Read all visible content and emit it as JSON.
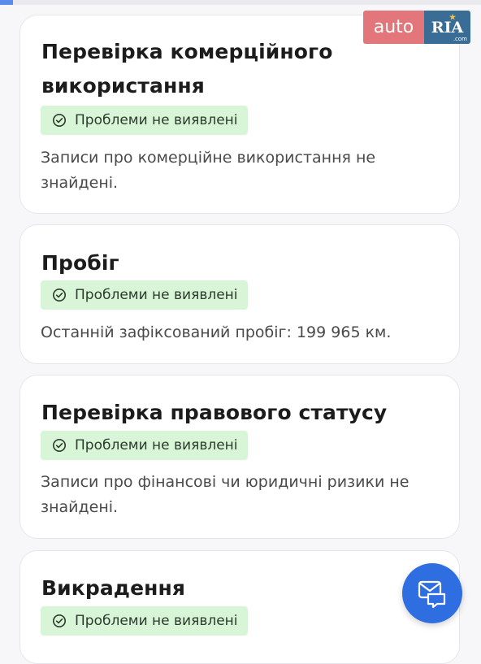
{
  "logo": {
    "auto": "auto",
    "ria": "RIA",
    "com": ".com"
  },
  "cards": [
    {
      "title": "Перевірка комерційного використання",
      "badge": "Проблеми не виявлені",
      "description": "Записи про комерційне використання не знайдені."
    },
    {
      "title": "Пробіг",
      "badge": "Проблеми не виявлені",
      "description": "Останній зафіксований пробіг: 199 965 км."
    },
    {
      "title": "Перевірка правового статусу",
      "badge": "Проблеми не виявлені",
      "description": "Записи про фінансові чи юридичні ризики не знайдені."
    },
    {
      "title": "Викрадення",
      "badge": "Проблеми не виявлені"
    }
  ],
  "icons": {
    "badge": "check-circle-icon",
    "fab": "chat-messages-icon"
  },
  "colors": {
    "badge_bg": "#d8f5d8",
    "fab": "#2f6ee0",
    "logo_auto": "#e2767a",
    "logo_ria": "#3a6d96"
  }
}
